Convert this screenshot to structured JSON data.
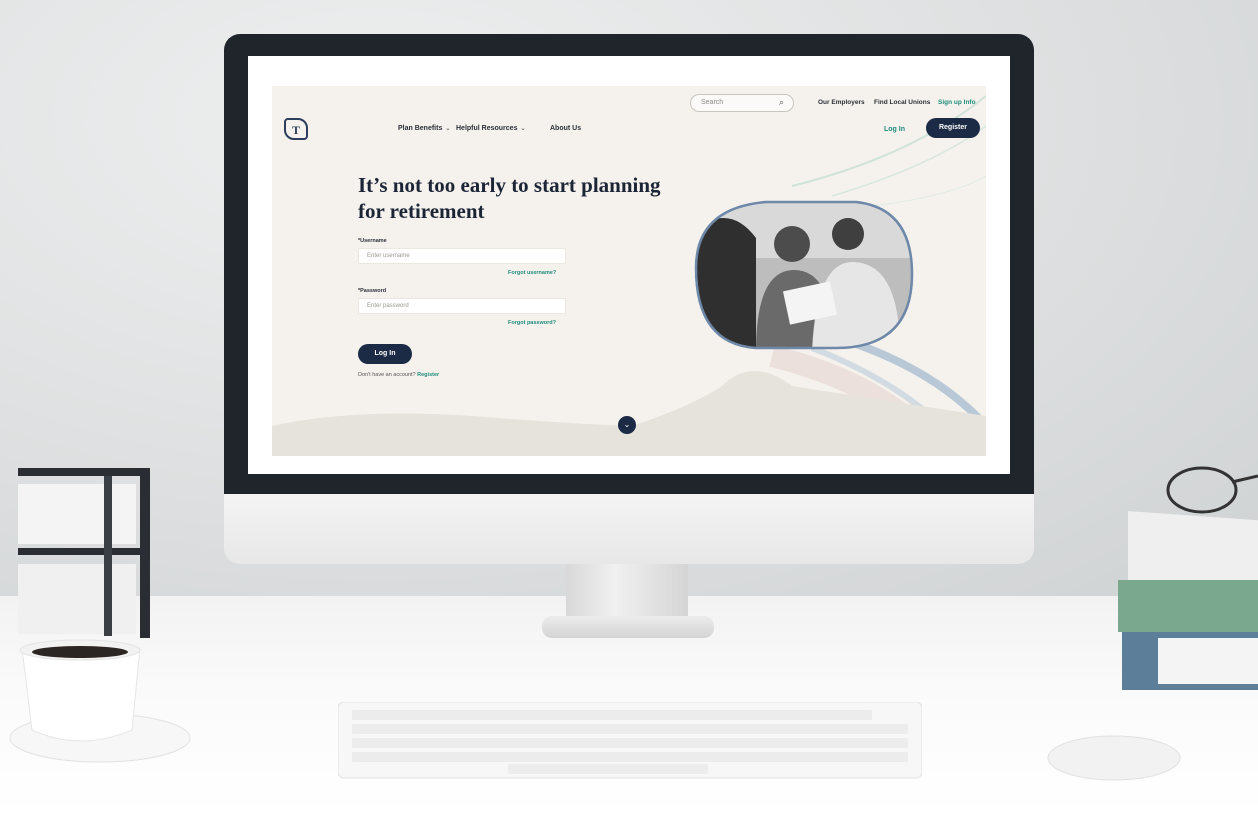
{
  "site": {
    "search": {
      "placeholder": "Search",
      "icon": "search-icon"
    },
    "util_links": [
      "Our Employers",
      "Find Local Unions",
      "Sign up Info"
    ],
    "logo_text": "",
    "nav": [
      {
        "label": "Plan Benefits",
        "has_dropdown": true
      },
      {
        "label": "Helpful Resources",
        "has_dropdown": true
      },
      {
        "label": "About Us",
        "has_dropdown": false
      }
    ],
    "login_link": "Log In",
    "register_button": "Register"
  },
  "hero": {
    "headline_line1": "It’s not too early to start planning",
    "headline_line2": "for retirement",
    "username": {
      "label": "*Username",
      "placeholder": "Enter username",
      "forgot": "Forgot username?"
    },
    "password": {
      "label": "*Password",
      "placeholder": "Enter password",
      "forgot": "Forgot password?"
    },
    "login_button": "Log In",
    "no_account_text": "Don't have an account?",
    "no_account_link": "Register"
  },
  "colors": {
    "navy": "#1b2a45",
    "teal": "#1f8b7a",
    "page_bg": "#f5f2ed"
  }
}
